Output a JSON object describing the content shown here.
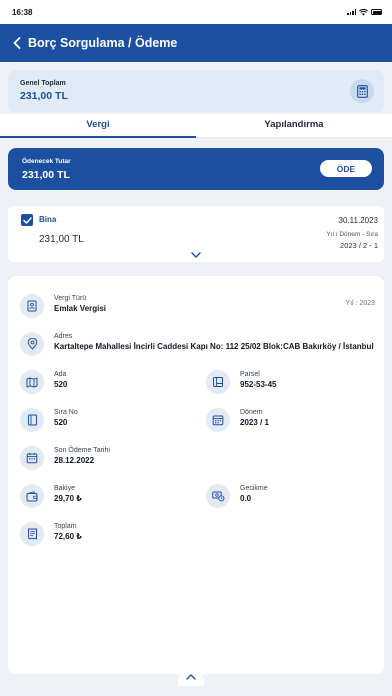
{
  "status_bar": {
    "time": "16:38"
  },
  "header": {
    "title": "Borç Sorgulama / Ödeme",
    "back_icon": "chevron-left-icon"
  },
  "summary": {
    "label": "Genel Toplam",
    "value": "231,00 TL",
    "icon": "calculator-icon"
  },
  "tabs": [
    {
      "label": "Vergi",
      "active": true
    },
    {
      "label": "Yapılandırma",
      "active": false
    }
  ],
  "payment": {
    "label": "Ödenecek Tutar",
    "value": "231,00 TL",
    "button_label": "ÖDE"
  },
  "tax_item": {
    "name": "Bina",
    "amount": "231,00 TL",
    "date": "30.11.2023",
    "period_label": "Yıl / Dönem - Sıra",
    "period": "2023 / 2 - 1",
    "checked": true
  },
  "details": {
    "year_note": "Yıl : 2023",
    "vergi_turu": {
      "label": "Vergi Türü",
      "value": "Emlak Vergisi"
    },
    "adres": {
      "label": "Adres",
      "value": "Kartaltepe Mahallesi İncirli Caddesi Kapı No: 112  25/02 Blok:CAB Bakırköy / İstanbul"
    },
    "ada": {
      "label": "Ada",
      "value": "520"
    },
    "parsel": {
      "label": "Parsel",
      "value": "952-53-45"
    },
    "sira_no": {
      "label": "Sıra No",
      "value": "520"
    },
    "donem": {
      "label": "Dönem",
      "value": "2023 / 1"
    },
    "son_odeme": {
      "label": "Son Ödeme Tarihi",
      "value": "28.12.2022"
    },
    "bakiye": {
      "label": "Bakiye",
      "value": "29,70 ₺"
    },
    "gecikme": {
      "label": "Gecikme",
      "value": "0.0"
    },
    "toplam": {
      "label": "Toplam",
      "value": "72,60 ₺"
    }
  },
  "colors": {
    "primary": "#1d4fa1",
    "summary_bg": "#e1ebf7",
    "page_bg": "#eef2f7",
    "icon_bg": "#e4eaf3"
  }
}
